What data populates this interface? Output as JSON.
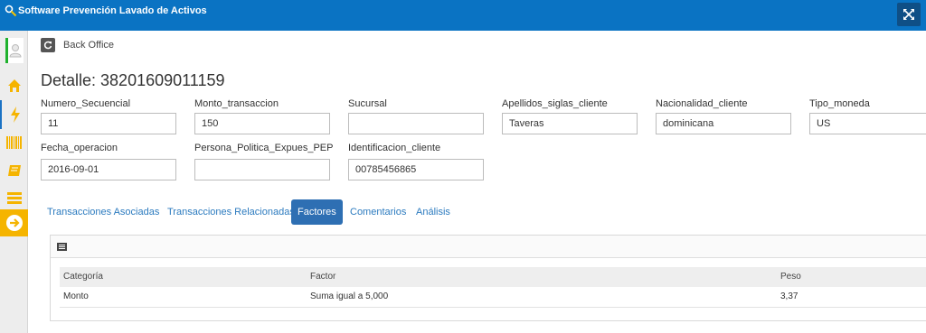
{
  "app": {
    "title": "Software Prevención Lavado de Activos"
  },
  "breadcrumb": {
    "label": "Back Office"
  },
  "page": {
    "title": "Detalle: 38201609011159"
  },
  "fields": {
    "numero_secuencial": {
      "label": "Numero_Secuencial",
      "value": "11"
    },
    "monto_transaccion": {
      "label": "Monto_transaccion",
      "value": "150"
    },
    "sucursal": {
      "label": "Sucursal",
      "value": ""
    },
    "apellidos_siglas_cliente": {
      "label": "Apellidos_siglas_cliente",
      "value": "Taveras"
    },
    "nacionalidad_cliente": {
      "label": "Nacionalidad_cliente",
      "value": "dominicana"
    },
    "tipo_moneda": {
      "label": "Tipo_moneda",
      "value": "US"
    },
    "fecha_operacion": {
      "label": "Fecha_operacion",
      "value": "2016-09-01"
    },
    "persona_politica": {
      "label": "Persona_Politica_Expues_PEP",
      "value": ""
    },
    "identificacion_cliente": {
      "label": "Identificacion_cliente",
      "value": "00785456865"
    }
  },
  "tabs": [
    {
      "label": "Transacciones Asociadas",
      "active": false
    },
    {
      "label": "Transacciones Relacionadas",
      "active": false
    },
    {
      "label": "Factores",
      "active": true
    },
    {
      "label": "Comentarios",
      "active": false
    },
    {
      "label": "Análisis",
      "active": false
    }
  ],
  "factores_table": {
    "columns": [
      "Categoría",
      "Factor",
      "Peso"
    ],
    "rows": [
      [
        "Monto",
        "Suma igual a 5,000",
        "3,37"
      ]
    ]
  },
  "icons": {
    "logo": "key-magnifier-icon",
    "expand": "fullscreen-icon",
    "refresh": "refresh-icon",
    "panel": "list-icon",
    "sidebar": [
      "user-icon",
      "home-icon",
      "bolt-icon",
      "barcode-icon",
      "book-icon",
      "stack-icon",
      "arrow-circle-icon"
    ]
  },
  "colors": {
    "topbar": "#0a73c3",
    "active_tab": "#2e6fb3",
    "link": "#2c7bbf",
    "accent_yellow": "#f5b400",
    "user_indicator": "#1fb12d"
  }
}
